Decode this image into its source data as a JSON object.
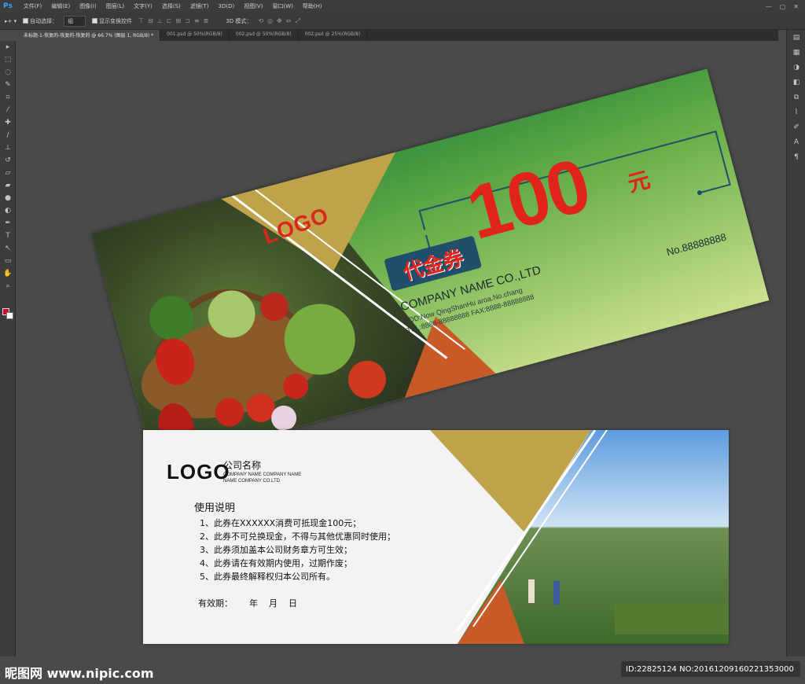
{
  "app": {
    "logo": "Ps",
    "menu": [
      "文件(F)",
      "编辑(E)",
      "图像(I)",
      "图层(L)",
      "文字(Y)",
      "选择(S)",
      "滤镜(T)",
      "3D(D)",
      "视图(V)",
      "窗口(W)",
      "帮助(H)"
    ],
    "window_controls": [
      "—",
      "▢",
      "✕"
    ]
  },
  "options": {
    "auto_select_label": "自动选择：",
    "auto_select_value": "组",
    "show_transform_label": "显示变换控件",
    "mode_3d_label": "3D 模式："
  },
  "tabs": [
    {
      "label": "未标题-1-恢复的-恢复的-恢复的 @ 66.7% (图层 1, RGB/8) *",
      "active": true
    },
    {
      "label": "001.psd @ 50%(RGB/8)",
      "active": false
    },
    {
      "label": "002.psd @ 50%(RGB/8)",
      "active": false
    },
    {
      "label": "002.psd @ 25%(RGB/8)",
      "active": false
    }
  ],
  "colors": {
    "foreground": "#c8102e",
    "background": "#ffffff",
    "voucher_red": "#e0241c",
    "voucher_green": "#2f8a3a",
    "accent_gold": "#bfa24a",
    "accent_orange": "#c85a28"
  },
  "tools_left": [
    "move-tool",
    "marquee-tool",
    "lasso-tool",
    "quick-select-tool",
    "crop-tool",
    "eyedropper-tool",
    "healing-tool",
    "brush-tool",
    "stamp-tool",
    "history-brush-tool",
    "eraser-tool",
    "gradient-tool",
    "blur-tool",
    "dodge-tool",
    "pen-tool",
    "type-tool",
    "path-select-tool",
    "shape-tool",
    "hand-tool",
    "zoom-tool"
  ],
  "tools_right": [
    "history-icon",
    "properties-icon",
    "adjustments-icon",
    "layers-icon",
    "channels-icon",
    "paths-icon",
    "brush-icon",
    "character-icon",
    "paragraph-icon"
  ],
  "front": {
    "logo": "LOGO",
    "amount": "100",
    "unit": "元",
    "voucher_label": "代金券",
    "company": "COMPANY NAME CO.,LTD",
    "address": "ADD:Now QingShanHu aroa.No.chang",
    "phone": "TEL:8888-88888888  FAX:8888-88888888",
    "serial": "No.88888888"
  },
  "back": {
    "logo": "LOGO",
    "company_cn": "公司名称",
    "company_en_1": "COMPANY NAME COMPANY NAME",
    "company_en_2": "NAME COMPANY CO.LTD",
    "usage_title": "使用说明",
    "rules": [
      "1、此券在XXXXXX消费可抵现金100元；",
      "2、此券不可兑换现金，不得与其他优惠同时使用；",
      "3、此券须加盖本公司财务章方可生效；",
      "4、此券请在有效期内使用，过期作废；",
      "5、此券最终解释权归本公司所有。"
    ],
    "validity": "有效期：      年    月    日"
  },
  "watermark": {
    "left": "昵图网 www.nipic.com",
    "right": "ID:22825124 NO:20161209160221353000"
  }
}
